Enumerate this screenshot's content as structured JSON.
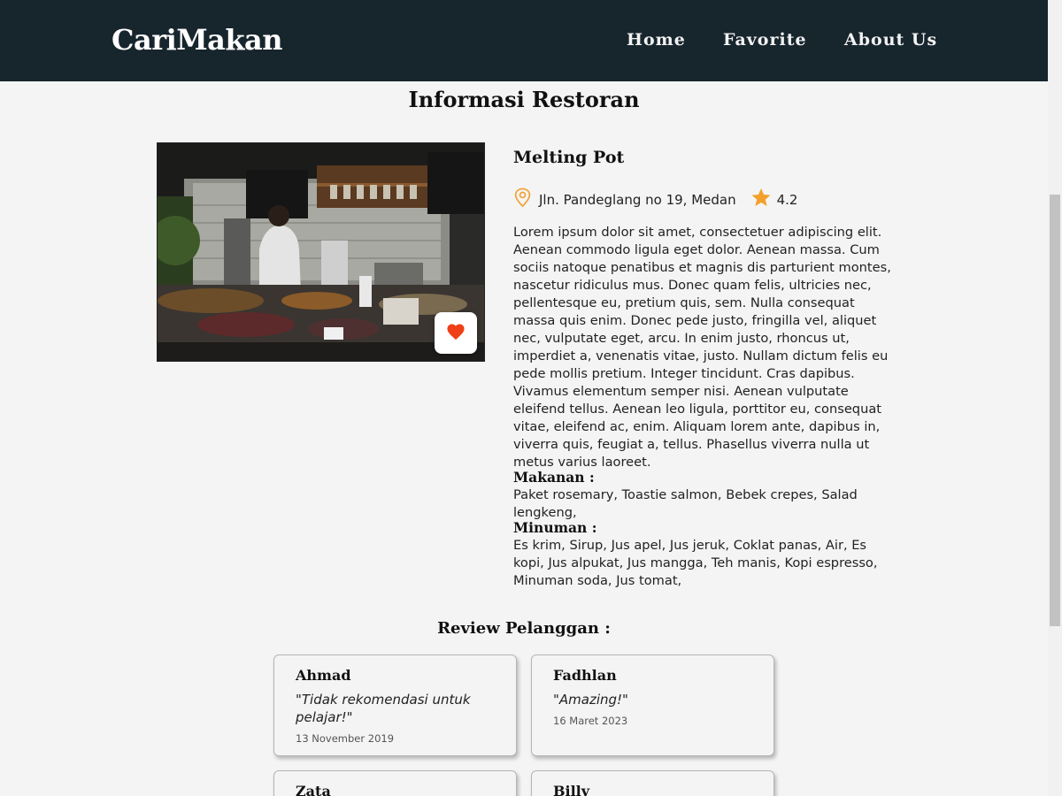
{
  "header": {
    "brand": "CariMakan",
    "nav": [
      "Home",
      "Favorite",
      "About Us"
    ]
  },
  "page": {
    "title": "Informasi Restoran"
  },
  "restaurant": {
    "name": "Melting Pot",
    "address": "Jln. Pandeglang no 19, Medan",
    "rating": "4.2",
    "description": "Lorem ipsum dolor sit amet, consectetuer adipiscing elit. Aenean commodo ligula eget dolor. Aenean massa. Cum sociis natoque penatibus et magnis dis parturient montes, nascetur ridiculus mus. Donec quam felis, ultricies nec, pellentesque eu, pretium quis, sem. Nulla consequat massa quis enim. Donec pede justo, fringilla vel, aliquet nec, vulputate eget, arcu. In enim justo, rhoncus ut, imperdiet a, venenatis vitae, justo. Nullam dictum felis eu pede mollis pretium. Integer tincidunt. Cras dapibus. Vivamus elementum semper nisi. Aenean vulputate eleifend tellus. Aenean leo ligula, porttitor eu, consequat vitae, eleifend ac, enim. Aliquam lorem ante, dapibus in, viverra quis, feugiat a, tellus. Phasellus viverra nulla ut metus varius laoreet.",
    "food_label": "Makanan :",
    "food": "Paket rosemary, Toastie salmon, Bebek crepes, Salad lengkeng,",
    "drink_label": "Minuman :",
    "drinks": "Es krim, Sirup, Jus apel, Jus jeruk, Coklat panas, Air, Es kopi, Jus alpukat, Jus mangga, Teh manis, Kopi espresso, Minuman soda, Jus tomat,"
  },
  "reviews": {
    "title": "Review Pelanggan :",
    "items": [
      {
        "name": "Ahmad",
        "text": "\"Tidak rekomendasi untuk pelajar!\"",
        "date": "13 November 2019"
      },
      {
        "name": "Fadhlan",
        "text": "\"Amazing!\"",
        "date": "16 Maret 2023"
      },
      {
        "name": "Zata",
        "text": "",
        "date": ""
      },
      {
        "name": "Billy",
        "text": "",
        "date": ""
      }
    ]
  },
  "colors": {
    "navbar": "#17252d",
    "favorite_heart": "#ee3f17",
    "location_icon": "#f0a43a",
    "star_icon": "#f2a12b"
  },
  "icons": {
    "favorite": "heart-icon",
    "location": "map-pin-icon",
    "rating": "star-icon"
  }
}
